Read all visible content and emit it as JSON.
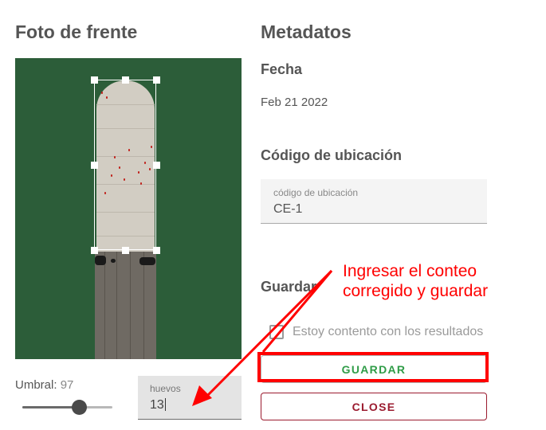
{
  "left_panel": {
    "title": "Foto de frente",
    "umbral": {
      "label": "Umbral:",
      "value": "97",
      "level_fraction": 0.64
    },
    "huevos": {
      "label": "huevos",
      "value": "13"
    }
  },
  "right_panel": {
    "title": "Metadatos",
    "fecha": {
      "label": "Fecha",
      "value": "Feb 21 2022"
    },
    "codigo": {
      "label": "Código de ubicación",
      "field_label": "código de ubicación",
      "value": "CE-1"
    },
    "guardar_section": {
      "label": "Guardar"
    },
    "checkbox": {
      "label": "Estoy contento con los resultados",
      "checked": false
    },
    "buttons": {
      "save_label": "GUARDAR",
      "close_label": "CLOSE"
    }
  },
  "annotation": {
    "line1": "Ingresar el conteo",
    "line2": "corregido y guardar",
    "color": "#ff0000"
  },
  "colors": {
    "photo_background": "#2c5d39",
    "save_text": "#2f9c47",
    "close_accent": "#9b1b2f"
  }
}
